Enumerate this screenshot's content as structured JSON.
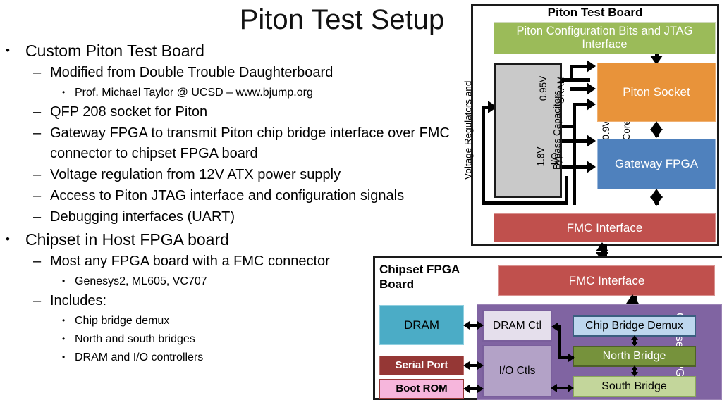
{
  "slide": {
    "title": "Piton Test Setup"
  },
  "bullets": [
    {
      "level": 1,
      "marker": "•",
      "text": "Custom Piton Test Board"
    },
    {
      "level": 2,
      "marker": "–",
      "text": "Modified from Double Trouble Daughterboard"
    },
    {
      "level": 3,
      "marker": "•",
      "text": "Prof. Michael Taylor @ UCSD – www.bjump.org"
    },
    {
      "level": 2,
      "marker": "–",
      "text": "QFP 208 socket for Piton"
    },
    {
      "level": 2,
      "marker": "–",
      "text": "Gateway FPGA to transmit Piton chip bridge interface over FMC connector to chipset FPGA board"
    },
    {
      "level": 2,
      "marker": "–",
      "text": "Voltage regulation from 12V ATX power supply"
    },
    {
      "level": 2,
      "marker": "–",
      "text": "Access to Piton JTAG interface and configuration signals"
    },
    {
      "level": 2,
      "marker": "–",
      "text": "Debugging interfaces (UART)"
    },
    {
      "level": 1,
      "marker": "•",
      "text": "Chipset in Host FPGA board"
    },
    {
      "level": 2,
      "marker": "–",
      "text": "Most any FPGA board with a FMC connector"
    },
    {
      "level": 3,
      "marker": "•",
      "text": "Genesys2, ML605, VC707"
    },
    {
      "level": 2,
      "marker": "–",
      "text": "Includes:"
    },
    {
      "level": 3,
      "marker": "•",
      "text": "Chip bridge demux"
    },
    {
      "level": 3,
      "marker": "•",
      "text": "North and south bridges"
    },
    {
      "level": 3,
      "marker": "•",
      "text": "DRAM and I/O controllers"
    }
  ],
  "piton_test_board": {
    "title": "Piton Test Board",
    "config_block": "Piton Configuration Bits and JTAG Interface",
    "voltage_block": {
      "name_line1": "Voltage Regulators and",
      "name_line2": "Bypass Capacitors",
      "rails": [
        {
          "voltage": "0.9V",
          "domain": "Core"
        },
        {
          "voltage": "0.95V",
          "domain": "SRAM"
        },
        {
          "voltage": "1.8V",
          "domain": "I/O"
        }
      ]
    },
    "socket": "Piton Socket",
    "gateway_fpga": "Gateway FPGA",
    "fmc_interface": "FMC Interface",
    "colors": {
      "config": "#9BBB59",
      "voltage": "#C9C9C9",
      "socket": "#E8933A",
      "gateway": "#4F81BD",
      "fmc": "#C0504D"
    }
  },
  "chipset_fpga_board": {
    "title_line1": "Chipset FPGA",
    "title_line2": "Board",
    "fmc_interface": "FMC Interface",
    "dram": "DRAM",
    "serial_port": "Serial Port",
    "boot_rom": "Boot ROM",
    "dram_ctl": "DRAM Ctl",
    "io_ctls": "I/O Ctls",
    "chip_bridge_demux": "Chip Bridge Demux",
    "north_bridge": "North Bridge",
    "south_bridge": "South Bridge",
    "chipset_fpga_label": "Chipset FPGA",
    "colors": {
      "fmc": "#C0504D",
      "dram": "#4BACC6",
      "serial_port": "#953735",
      "boot_rom": "#F6B6DC",
      "fpga_region": "#8064A2",
      "dram_ctl": "#E5DFEC",
      "io_ctls": "#B3A2C7",
      "chip_bridge_demux": "#BDD7EE",
      "north_bridge": "#76923C",
      "south_bridge": "#C3D69B"
    }
  }
}
